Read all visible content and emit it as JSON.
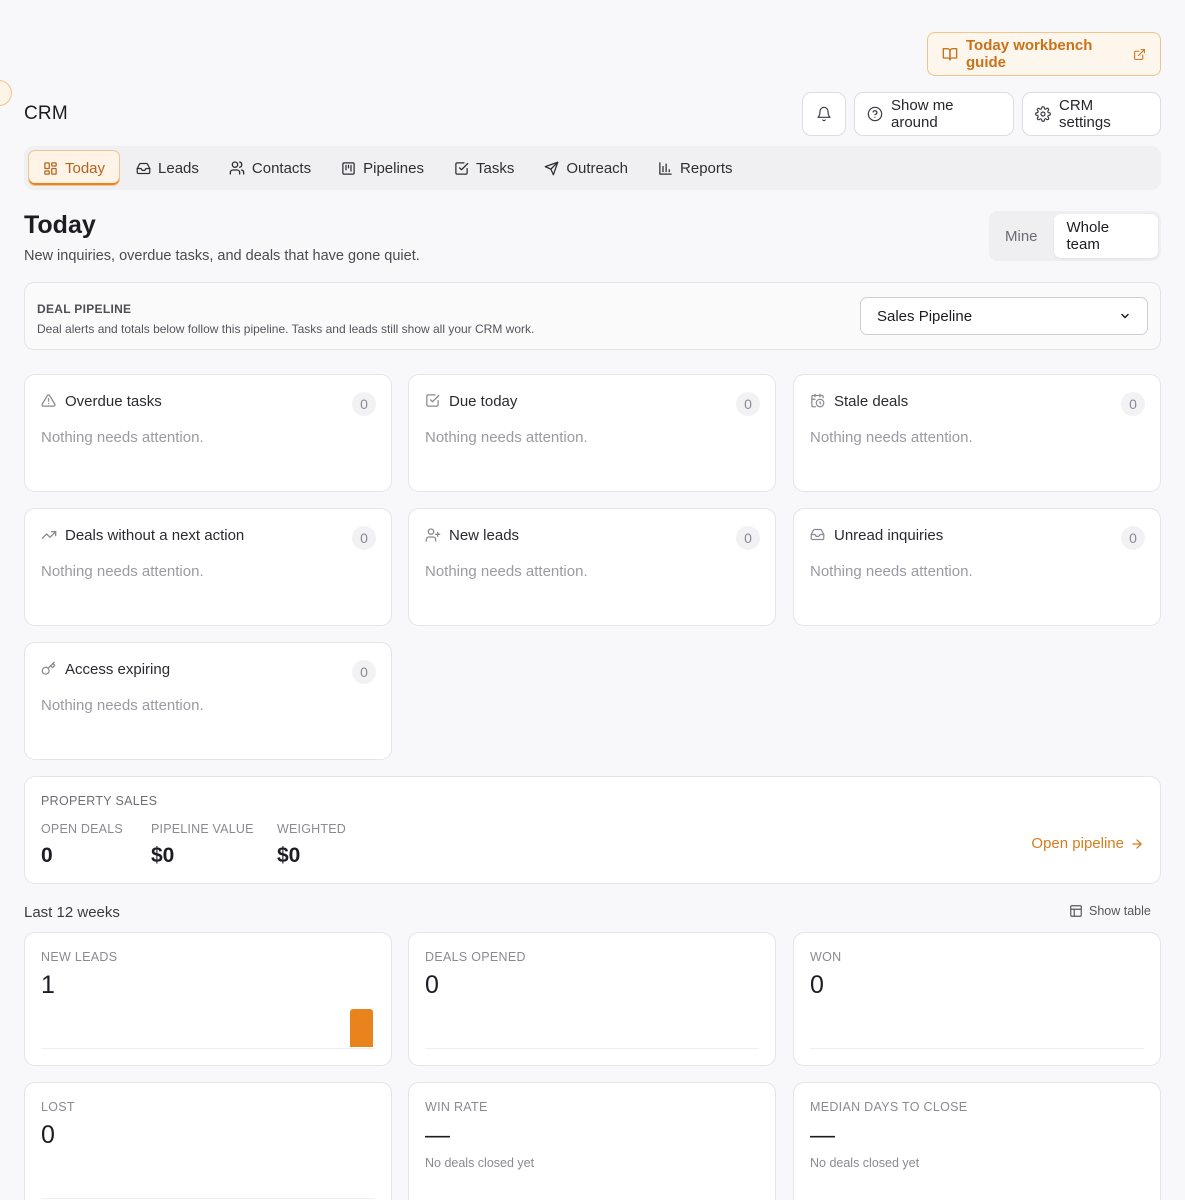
{
  "guide": {
    "label": "Today workbench guide"
  },
  "app": {
    "title": "CRM"
  },
  "header": {
    "tour_label": "Show me around",
    "settings_label": "CRM settings"
  },
  "tabs": [
    {
      "label": "Today",
      "icon": "dashboard-icon",
      "active": true
    },
    {
      "label": "Leads",
      "icon": "inbox-icon"
    },
    {
      "label": "Contacts",
      "icon": "users-icon"
    },
    {
      "label": "Pipelines",
      "icon": "kanban-icon"
    },
    {
      "label": "Tasks",
      "icon": "checkbox-icon"
    },
    {
      "label": "Outreach",
      "icon": "send-icon"
    },
    {
      "label": "Reports",
      "icon": "bar-chart-icon"
    }
  ],
  "page": {
    "title": "Today",
    "subtitle": "New inquiries, overdue tasks, and deals that have gone quiet."
  },
  "scope": {
    "options": [
      "Mine",
      "Whole team"
    ],
    "selected": "Whole team"
  },
  "pipeline_filter": {
    "heading": "DEAL PIPELINE",
    "description": "Deal alerts and totals below follow this pipeline. Tasks and leads still show all your CRM work.",
    "selected": "Sales Pipeline"
  },
  "alerts": [
    {
      "title": "Overdue tasks",
      "count": "0",
      "message": "Nothing needs attention.",
      "icon": "warning-triangle-icon"
    },
    {
      "title": "Due today",
      "count": "0",
      "message": "Nothing needs attention.",
      "icon": "checkbox-icon"
    },
    {
      "title": "Stale deals",
      "count": "0",
      "message": "Nothing needs attention.",
      "icon": "calendar-clock-icon"
    },
    {
      "title": "Deals without a next action",
      "count": "0",
      "message": "Nothing needs attention.",
      "icon": "trending-up-icon"
    },
    {
      "title": "New leads",
      "count": "0",
      "message": "Nothing needs attention.",
      "icon": "user-plus-icon"
    },
    {
      "title": "Unread inquiries",
      "count": "0",
      "message": "Nothing needs attention.",
      "icon": "inbox-icon"
    },
    {
      "title": "Access expiring",
      "count": "0",
      "message": "Nothing needs attention.",
      "icon": "key-icon"
    }
  ],
  "property_sales": {
    "heading": "PROPERTY SALES",
    "stats": [
      {
        "label": "OPEN DEALS",
        "value": "0"
      },
      {
        "label": "PIPELINE VALUE",
        "value": "$0"
      },
      {
        "label": "WEIGHTED",
        "value": "$0"
      }
    ],
    "link_label": "Open pipeline"
  },
  "weeks": {
    "label": "Last 12 weeks",
    "show_table_label": "Show table"
  },
  "metrics": [
    {
      "label": "NEW LEADS",
      "value": "1",
      "note": "",
      "spark_last_week_value": 1
    },
    {
      "label": "DEALS OPENED",
      "value": "0",
      "note": ""
    },
    {
      "label": "WON",
      "value": "0",
      "note": ""
    },
    {
      "label": "LOST",
      "value": "0",
      "note": ""
    },
    {
      "label": "WIN RATE",
      "value": "—",
      "note": "No deals closed yet"
    },
    {
      "label": "MEDIAN DAYS TO CLOSE",
      "value": "—",
      "note": "No deals closed yet"
    }
  ],
  "colors": {
    "accent": "#e8831d",
    "accent_text": "#c9721a"
  }
}
